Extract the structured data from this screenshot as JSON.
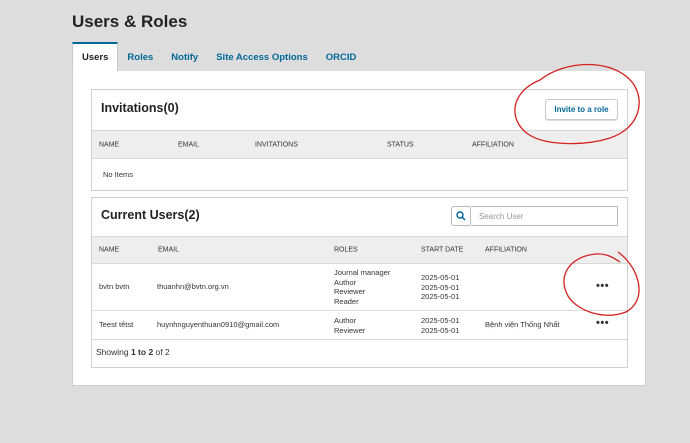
{
  "page": {
    "title": "Users & Roles"
  },
  "tabs": [
    {
      "label": "Users"
    },
    {
      "label": "Roles"
    },
    {
      "label": "Notify"
    },
    {
      "label": "Site Access Options"
    },
    {
      "label": "ORCID"
    }
  ],
  "invitations": {
    "title": "Invitations(0)",
    "invite_button": "Invite to a role",
    "columns": [
      "NAME",
      "EMAIL",
      "INVITATIONS",
      "STATUS",
      "AFFILIATION"
    ],
    "empty_text": "No Items"
  },
  "current_users": {
    "title": "Current Users(2)",
    "search_placeholder": "Search User",
    "columns": [
      "NAME",
      "EMAIL",
      "ROLES",
      "START DATE",
      "AFFILIATION"
    ],
    "rows": [
      {
        "name": "bvtn bvtn",
        "email": "thuanhn@bvtn.org.vn",
        "roles": [
          "Journal manager",
          "Author",
          "Reviewer",
          "Reader"
        ],
        "dates": [
          "2025-05-01",
          "2025-05-01",
          "2025-05-01"
        ],
        "affiliation": "",
        "actions": "•••"
      },
      {
        "name": "Teest têtst",
        "email": "huynhnguyenthuan0910@gmail.com",
        "roles": [
          "Author",
          "Reviewer"
        ],
        "dates": [
          "2025-05-01",
          "2025-05-01"
        ],
        "affiliation": "Bệnh viện Thống Nhất",
        "actions": "•••"
      }
    ],
    "footer": {
      "prefix": "Showing ",
      "range": "1 to 2",
      "suffix": " of 2"
    }
  },
  "colors": {
    "accent": "#006798",
    "annotation": "#d42020"
  },
  "icons": {
    "search": "search-icon"
  }
}
